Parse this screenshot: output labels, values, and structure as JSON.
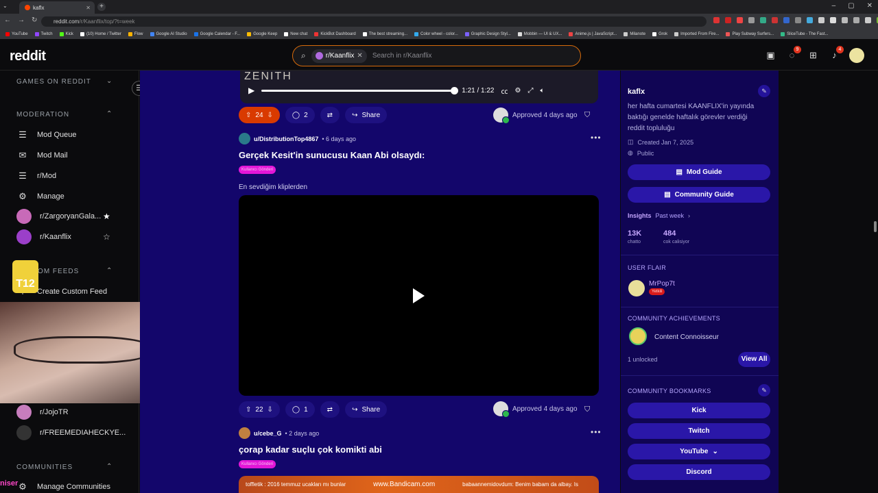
{
  "browser": {
    "tab_title": "kaflx",
    "url_host": "reddit.com",
    "url_path": "/r/Kaanflix/top/?t=week",
    "bookmarks": [
      "YouTube",
      "Twitch",
      "Kick",
      "(10) Home / Twitter",
      "Flow",
      "Google AI Studio",
      "Google Calendar - F...",
      "Google Keep",
      "New chat",
      "KickBot Dashboard",
      "The best streaming...",
      "Color wheel - color...",
      "Graphic Design Styl...",
      "Mobbin — UI & UX...",
      "Anime.js | JavaScript...",
      "Milanote",
      "Grok",
      "Imported From Fire...",
      "Play Subway Surfers...",
      "SliceTube - The Fast..."
    ]
  },
  "header": {
    "logo": "reddit",
    "search_chip": "r/Kaanflix",
    "search_placeholder": "Search in r/Kaanflix",
    "chat_badge": "9",
    "notif_badge": "4"
  },
  "sidebar": {
    "games_heading": "GAMES ON REDDIT",
    "moderation_heading": "MODERATION",
    "moderation_items": [
      "Mod Queue",
      "Mod Mail",
      "r/Mod",
      "Manage"
    ],
    "mod_communities": [
      "r/ZargoryanGala...",
      "r/Kaanflix"
    ],
    "feeds_heading": "CUSTOM FEEDS",
    "create_feed": "Create Custom Feed",
    "other_communities": [
      "r/JojoTR",
      "r/FREEMEDIAHECKYE..."
    ],
    "communities_heading": "COMMUNITIES",
    "manage_communities": "Manage Communities"
  },
  "overlay": {
    "sticker_text": "T12",
    "stream_text": "niser"
  },
  "posts": [
    {
      "video_overlay_text": "ZENITH",
      "time_display": "1:21 / 1:22",
      "progress": 0.99,
      "votes": "24",
      "comments": "2",
      "share": "Share",
      "approved": "Approved 4 days ago",
      "upvoted": true
    },
    {
      "author": "u/DistributionTop4867",
      "age": "• 6 days ago",
      "title": "Gerçek Kesit'in sunucusu Kaan Abi olsaydı:",
      "flair": "Kullanıcı Gönderi",
      "body": "En sevdiğim kliplerden",
      "votes": "22",
      "comments": "1",
      "share": "Share",
      "approved": "Approved 4 days ago"
    },
    {
      "author": "u/cebe_G",
      "age": "• 2 days ago",
      "title": "çorap kadar suçlu çok komikti abi",
      "flair": "Kullanıcı Gönderi",
      "thumb_left": "toffletik : 2016 temmuz ucakları mı bunlar",
      "thumb_center": "www.Bandicam.com",
      "thumb_right": "babaannemidovdum: Benim babam da albay. Is"
    }
  ],
  "right": {
    "community_name": "kaflx",
    "description": "her hafta cumartesi KAANFLIX'in yayında baktığı genelde haftalık görevler verdiği reddit topluluğu",
    "created": "Created Jan 7, 2025",
    "visibility": "Public",
    "mod_guide": "Mod Guide",
    "community_guide": "Community Guide",
    "insights_label": "Insights",
    "insights_range": "Past week",
    "stat1_value": "13K",
    "stat1_label": "chatto",
    "stat2_value": "484",
    "stat2_label": "cok calisiyor",
    "user_flair_heading": "USER FLAIR",
    "user_flair_name": "MrPop7t",
    "user_flair_tag": "Yetkili",
    "achievements_heading": "COMMUNITY ACHIEVEMENTS",
    "achievement_name": "Content Connoisseur",
    "unlocked": "1 unlocked",
    "view_all": "View All",
    "bookmarks_heading": "COMMUNITY BOOKMARKS",
    "bookmark_links": [
      "Kick",
      "Twitch",
      "YouTube",
      "Discord"
    ]
  },
  "colors": {
    "feed_bg": "#13066b",
    "right_bg": "#100554",
    "upvote_active": "#d93a00",
    "flair": "#e316d8",
    "button": "#2a17a8",
    "search_border": "#d86b0a"
  }
}
